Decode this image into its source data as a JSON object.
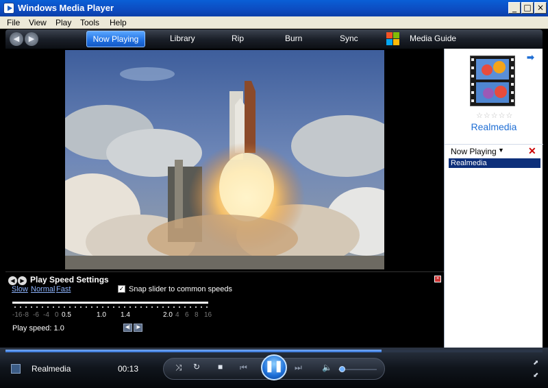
{
  "window": {
    "title": "Windows Media Player"
  },
  "menu": [
    "File",
    "View",
    "Play",
    "Tools",
    "Help"
  ],
  "nav": {
    "tabs": [
      "Now Playing",
      "Library",
      "Rip",
      "Burn",
      "Sync",
      "Media Guide"
    ],
    "active_tab": "Now Playing"
  },
  "right_pane": {
    "album_title": "Realmedia",
    "rating_stars": "☆☆☆☆☆",
    "now_playing_label": "Now Playing",
    "playlist": [
      "Realmedia"
    ]
  },
  "speed_panel": {
    "title": "Play Speed Settings",
    "links": [
      "Slow",
      "Normal",
      "Fast"
    ],
    "snap_label": "Snap slider to common speeds",
    "snap_checked": true,
    "ticks": [
      "-16",
      "-8",
      "-6",
      "-4",
      "0",
      "0.5",
      "1.0",
      "1.4",
      "2.0",
      "4",
      "6",
      "8",
      "16"
    ],
    "speed_label": "Play speed: 1.0"
  },
  "transport": {
    "media_title": "Realmedia",
    "time": "00:13",
    "seek_progress": 0.7,
    "volume": 0.05
  },
  "colors": {
    "accent": "#1f6ed4",
    "selection": "#0d2f7a",
    "titlebar": "#0c4bc0"
  }
}
